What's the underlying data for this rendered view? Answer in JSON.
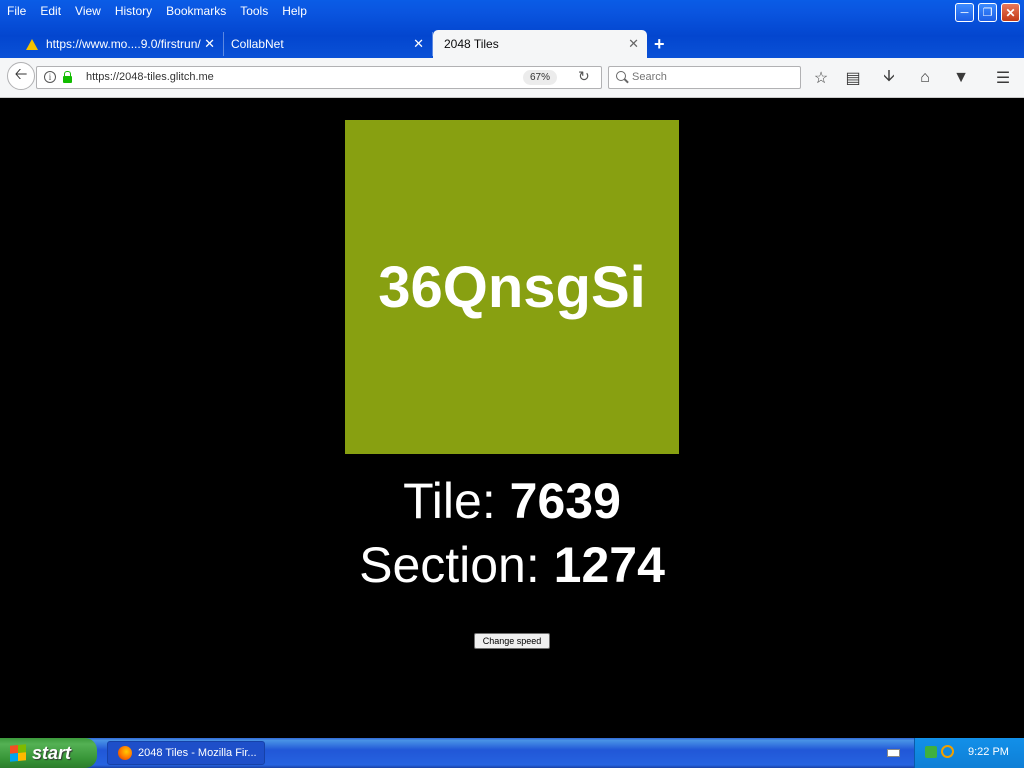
{
  "menu": [
    "File",
    "Edit",
    "View",
    "History",
    "Bookmarks",
    "Tools",
    "Help"
  ],
  "window_controls": [
    "minimize-icon",
    "restore-icon",
    "close-icon"
  ],
  "tabs": [
    {
      "label": "https://www.mo....9.0/firstrun/",
      "icon": "warning-icon",
      "active": false
    },
    {
      "label": "CollabNet",
      "active": false
    },
    {
      "label": "2048 Tiles",
      "active": true
    }
  ],
  "navbar": {
    "url": "https://2048-tiles.glitch.me",
    "zoom": "67%",
    "search_placeholder": "Search"
  },
  "page": {
    "tile_text": "36QnsgSi",
    "tile_color": "#88a011",
    "tile_label": "Tile:",
    "tile_value": "7639",
    "section_label": "Section:",
    "section_value": "1274",
    "change_speed_label": "Change speed"
  },
  "taskbar": {
    "start_label": "start",
    "task_label": "2048 Tiles - Mozilla Fir...",
    "clock": "9:22 PM"
  }
}
